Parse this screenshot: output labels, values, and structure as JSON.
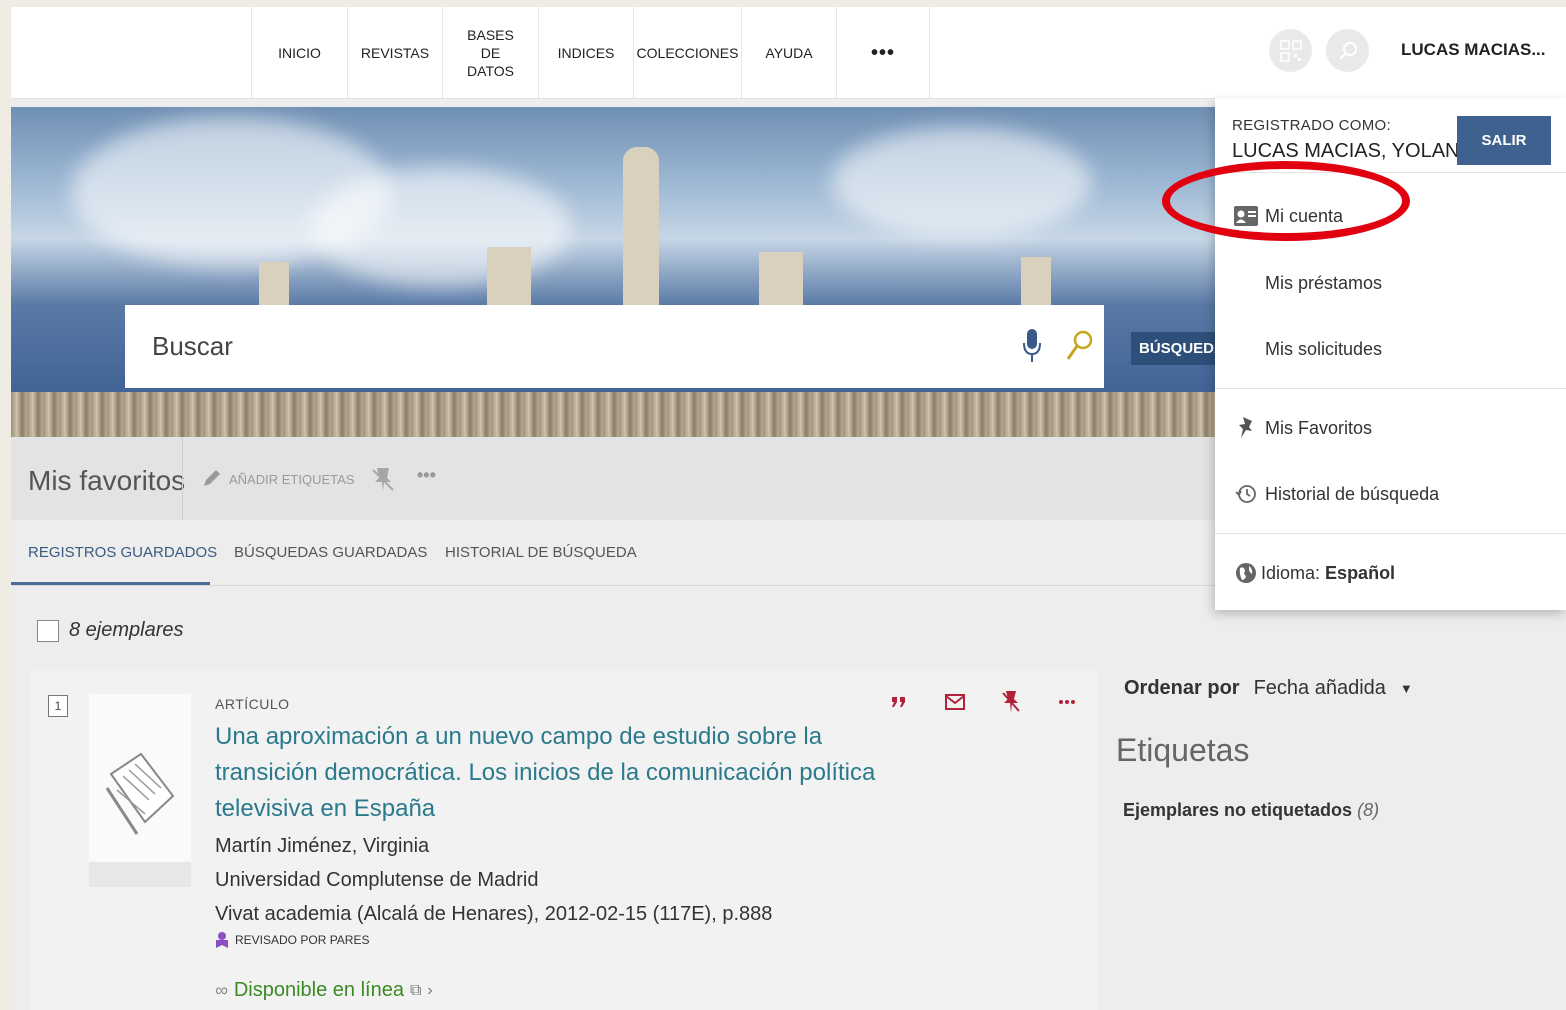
{
  "nav": {
    "items": [
      "INICIO",
      "REVISTAS",
      "BASES DE DATOS",
      "INDICES",
      "COLECCIONES",
      "AYUDA"
    ],
    "more": "•••"
  },
  "user": {
    "display_name": "LUCAS MACIAS..."
  },
  "search": {
    "placeholder": "Buscar",
    "advanced_label": "BÚSQUEDA"
  },
  "favorites": {
    "title": "Mis favoritos",
    "add_tags": "AÑADIR ETIQUETAS",
    "more": "•••"
  },
  "tabs": [
    "REGISTROS GUARDADOS",
    "BÚSQUEDAS GUARDADAS",
    "HISTORIAL DE BÚSQUEDA"
  ],
  "results": {
    "count_label": "8 ejemplares"
  },
  "record": {
    "number": "1",
    "type": "ARTÍCULO",
    "title": "Una aproximación a un nuevo campo de estudio sobre la transición democrática. Los inicios de la comunicación política televisiva en España",
    "author": "Martín Jiménez, Virginia",
    "publisher": "Universidad Complutense de Madrid",
    "source": "Vivat academia (Alcalá de Henares), 2012-02-15 (117E), p.888",
    "peer_reviewed": "REVISADO POR PARES",
    "availability": "Disponible en línea"
  },
  "sidebar": {
    "sort_label": "Ordenar por",
    "sort_value": "Fecha añadida",
    "tags_title": "Etiquetas",
    "untagged_label": "Ejemplares no etiquetados",
    "untagged_count": "(8)"
  },
  "dropdown": {
    "registered_as": "REGISTRADO COMO:",
    "user_full": "LUCAS MACIAS, YOLANDA",
    "logout": "SALIR",
    "items": [
      "Mi cuenta",
      "Mis préstamos",
      "Mis solicitudes",
      "Mis Favoritos",
      "Historial de búsqueda"
    ],
    "language_label": "Idioma:",
    "language_value": "Español"
  },
  "colors": {
    "accent": "#3f6190",
    "link": "#2a7a8c",
    "action": "#b0233a",
    "highlight": "#e00010",
    "online": "#3b8a24"
  }
}
